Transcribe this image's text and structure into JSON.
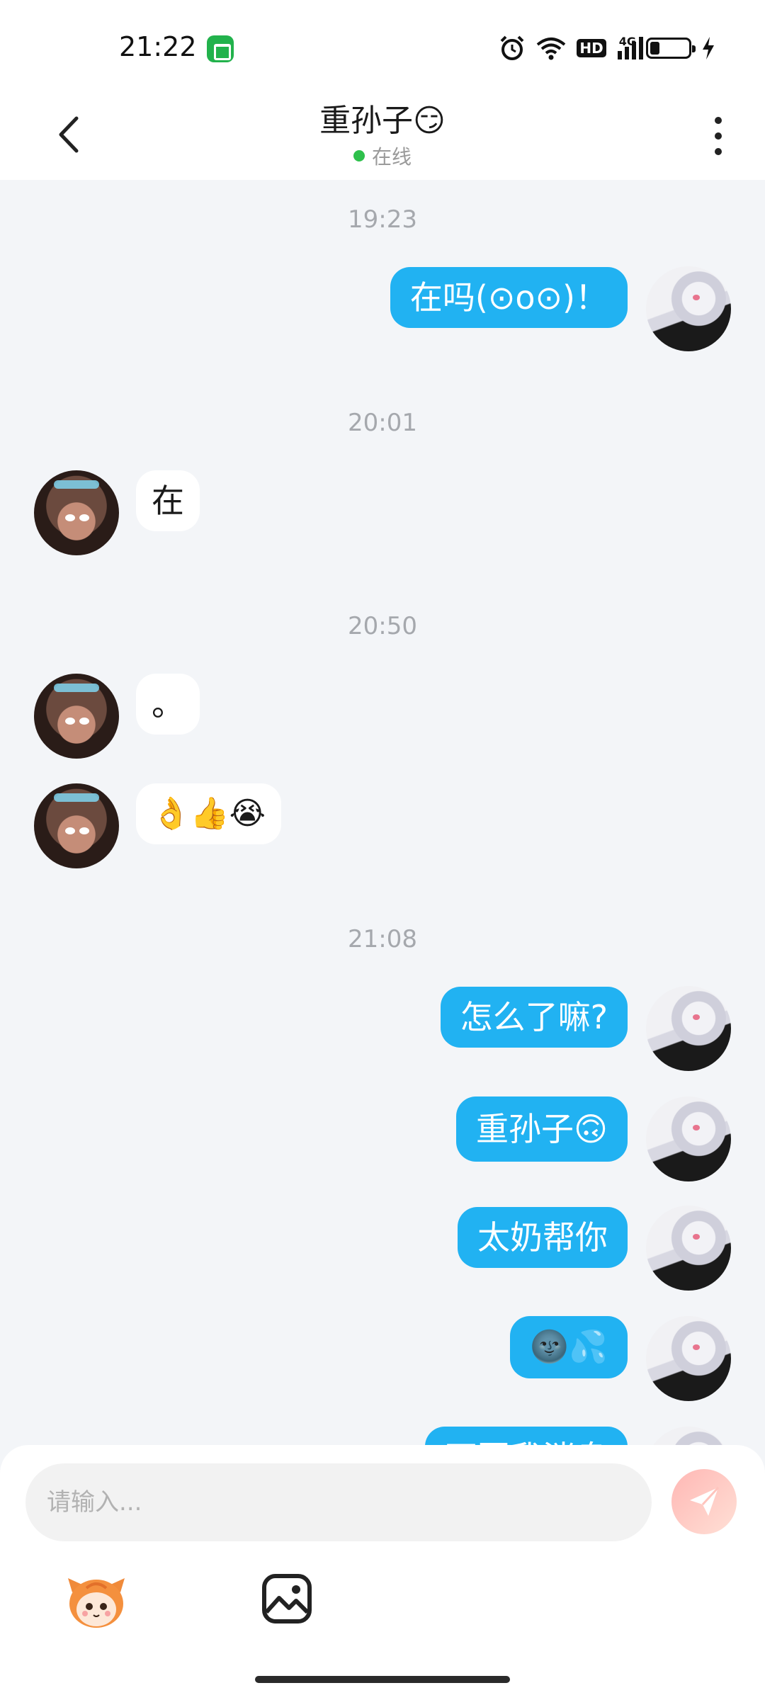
{
  "status_bar": {
    "time": "21:22",
    "hd_label": "HD",
    "network_label": "4G",
    "battery_level": 0.25
  },
  "header": {
    "title": "重孙子😏",
    "online_status": "在线"
  },
  "messages": {
    "ts1": "19:23",
    "m1": "在吗(⊙o⊙)！",
    "ts2": "20:01",
    "m2": "在",
    "ts3": "20:50",
    "m3": "。",
    "m4": "👌👍😭",
    "ts4": "21:08",
    "m5": "怎么了嘛?",
    "m6": "重孙子🙃",
    "m7": "太奶帮你",
    "m8": "🌚💦",
    "m9": "不回我消息"
  },
  "composer": {
    "placeholder": "请输入..."
  },
  "colors": {
    "my_bubble": "#21b2f2",
    "background": "#f3f5f8",
    "online": "#2ec04c"
  }
}
